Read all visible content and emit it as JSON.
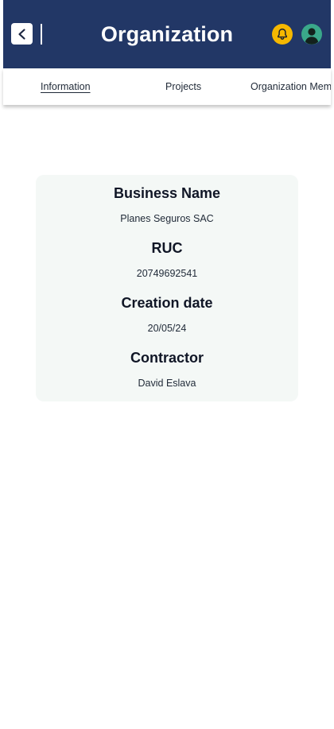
{
  "header": {
    "title": "Organization",
    "back_icon": "chevron-left-icon",
    "notification_icon": "bell-icon",
    "profile_icon": "user-avatar-icon"
  },
  "tabs": [
    {
      "label": "Information",
      "active": true
    },
    {
      "label": "Projects",
      "active": false
    },
    {
      "label": "Organization Members",
      "active": false
    }
  ],
  "info": {
    "business_name": {
      "label": "Business Name",
      "value": "Planes Seguros SAC"
    },
    "ruc": {
      "label": "RUC",
      "value": "20749692541"
    },
    "creation_date": {
      "label": "Creation date",
      "value": "20/05/24"
    },
    "contractor": {
      "label": "Contractor",
      "value": "David Eslava"
    }
  },
  "colors": {
    "header_bg": "#223766",
    "bell_bg": "#F6B800",
    "avatar_bg": "#3AA88A",
    "card_bg": "#F4F8F6"
  }
}
